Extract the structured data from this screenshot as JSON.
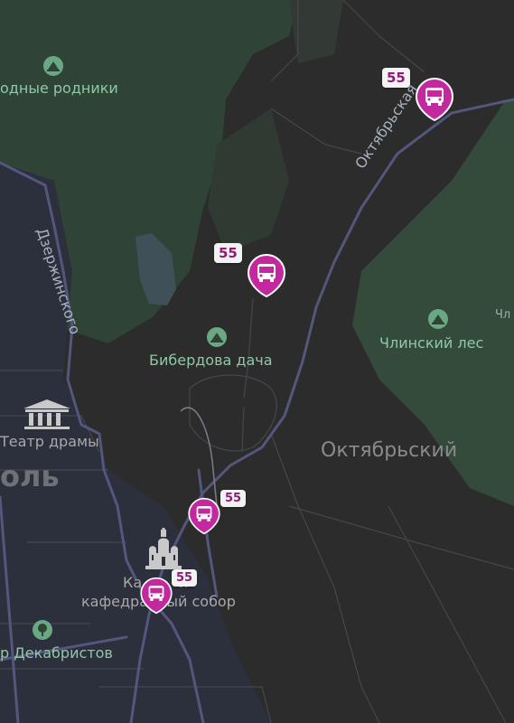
{
  "map": {
    "colors": {
      "background": "#2b2c2b",
      "forest": "#2f4336",
      "urban": "#2c2f3c",
      "road_main": "#54567d",
      "road_minor": "#45474c",
      "water": "#3f5058",
      "marker": "#c3289f",
      "badge_text": "#8c1b79",
      "badge_bg": "#f2f2f2"
    },
    "labels": {
      "springs": "одные родники",
      "biberdova": "Бибердова дача",
      "chlinsky": "Члинский лес",
      "oktyabrsky": "Октябрьский",
      "oktyabrskaya": "Октябрьская",
      "dzerzhinskogo": "Дзержинского",
      "theatre": "Театр драмы",
      "city_fragment": "оль",
      "cathedral_line1": "Ка        й",
      "cathedral_line2": "кафедра    ый собор",
      "dekabristov": "р Декабристов",
      "chl_edge": "Чл"
    },
    "icons": {
      "springs": "park-icon",
      "biberdova": "park-icon",
      "chlinsky": "park-icon",
      "theatre": "theatre-icon",
      "cathedral": "cathedral-icon",
      "dekabristov": "tree-icon"
    },
    "buses": [
      {
        "route": "55",
        "icon": "bus-icon"
      },
      {
        "route": "55",
        "icon": "bus-icon"
      },
      {
        "route": "55",
        "icon": "bus-icon"
      },
      {
        "route": "55",
        "icon": "bus-icon"
      }
    ]
  }
}
